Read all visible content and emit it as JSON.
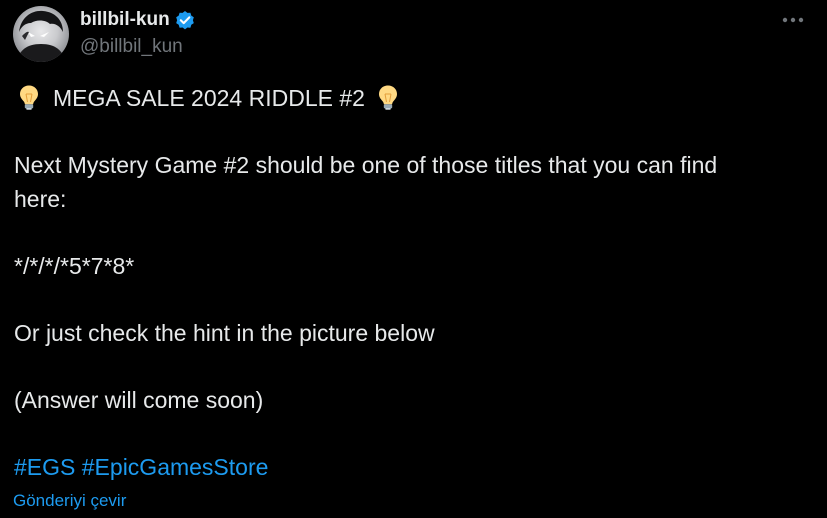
{
  "author": {
    "display_name": "billbil-kun",
    "handle": "@billbil_kun",
    "verified_icon": "verified-badge-icon",
    "avatar_icon": "avatar-image"
  },
  "more_icon": "more-options-icon",
  "tweet": {
    "title_text": "MEGA SALE 2024 RIDDLE #2",
    "title_icon": "lightbulb-emoji",
    "line1": "Next Mystery Game #2 should be one of those titles that you can find",
    "line2": "here:",
    "code": "*/*/*/*5*7*8*",
    "hint": "Or just check the hint in the picture below",
    "answer": "(Answer will come soon)",
    "hashtags": [
      "#EGS",
      "#EpicGamesStore"
    ]
  },
  "translate_label": "Gönderiyi çevir",
  "colors": {
    "background": "#000000",
    "text": "#e7e9ea",
    "secondary": "#71767b",
    "accent": "#1d9bf0"
  }
}
